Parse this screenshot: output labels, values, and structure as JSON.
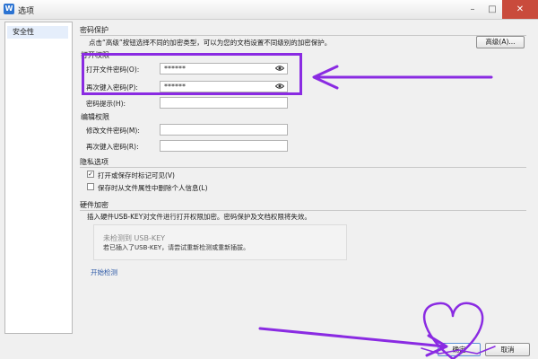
{
  "window": {
    "title": "选项",
    "app_logo": "W"
  },
  "sidebar": {
    "items": [
      {
        "label": "安全性",
        "selected": true
      }
    ]
  },
  "password_protection": {
    "title": "密码保护",
    "description": "点击“高级”按钮选择不同的加密类型，可以为您的文档设置不同级别的加密保护。",
    "advanced_button": "高级(A)...",
    "open_permission_title": "打开权限",
    "open_password_label": "打开文件密码(O):",
    "open_password_value": "******",
    "confirm_open_label": "再次键入密码(P):",
    "confirm_open_value": "******",
    "hint_label": "密码提示(H):",
    "edit_permission_title": "编辑权限",
    "modify_password_label": "修改文件密码(M):",
    "confirm_modify_label": "再次键入密码(R):"
  },
  "privacy": {
    "title": "隐私选项",
    "options": [
      {
        "label": "打开或保存时标记可见(V)",
        "checked": true
      },
      {
        "label": "保存时从文件属性中删除个人信息(L)",
        "checked": false
      }
    ]
  },
  "hardware": {
    "title": "硬件加密",
    "description": "插入硬件USB-KEY对文件进行打开权限加密。密码保护及文档权限将失效。",
    "status": "未检测到 USB-KEY",
    "status_hint": "若已插入了USB-KEY，请尝试重新检测或重新插拔。",
    "detect_link": "开始检测"
  },
  "footer": {
    "ok_button": "确定",
    "cancel_button": "取消"
  },
  "colors": {
    "annotation": "#8a2be2",
    "accent": "#2b73d2"
  }
}
